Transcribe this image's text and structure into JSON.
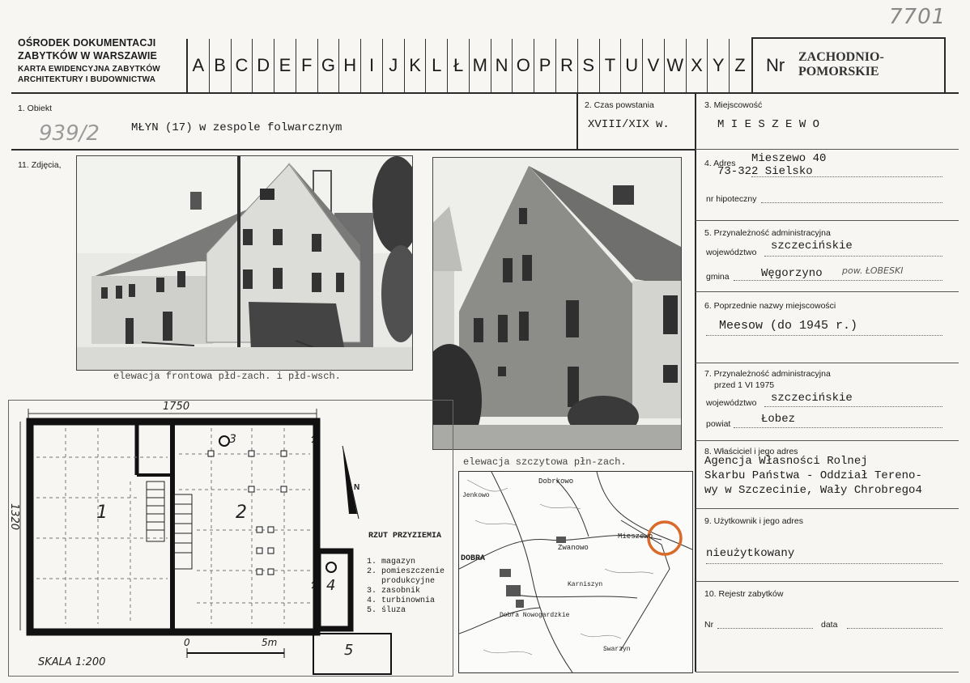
{
  "header": {
    "org_line1": "OŚRODEK DOKUMENTACJI",
    "org_line2": "ZABYTKÓW W WARSZAWIE",
    "org_line3": "KARTA EWIDENCYJNA ZABYTKÓW",
    "org_line4": "ARCHITEKTURY I BUDOWNICTWA",
    "letters": [
      "A",
      "B",
      "C",
      "D",
      "E",
      "F",
      "G",
      "H",
      "I",
      "J",
      "K",
      "L",
      "Ł",
      "M",
      "N",
      "O",
      "P",
      "R",
      "S",
      "T",
      "U",
      "V",
      "W",
      "X",
      "Y",
      "Z"
    ],
    "nr_label": "Nr",
    "region_stamp_line1": "ZACHODNIO-",
    "region_stamp_line2": "POMORSKIE",
    "corner_number": "7701"
  },
  "field1": {
    "label": "1. Obiekt",
    "value": "MŁYN (17) w zespole folwarcznym",
    "handwritten": "939/2"
  },
  "field2": {
    "label": "2. Czas powstania",
    "value": "XVIII/XIX w."
  },
  "field3": {
    "label": "3. Miejscowość",
    "value": "M I E S Z E W O"
  },
  "field11": {
    "label": "11. Zdjęcia,"
  },
  "field4": {
    "label": "4. Adres",
    "line1": "Mieszewo 40",
    "line2": "73-322 Sielsko",
    "hip_label": "nr hipoteczny"
  },
  "field5": {
    "label": "5. Przynależność administracyjna",
    "woj_label": "województwo",
    "woj_value": "szczecińskie",
    "gmina_label": "gmina",
    "gmina_value": "Węgorzyno",
    "gmina_note": "pow. ŁOBESKI"
  },
  "field6": {
    "label": "6. Poprzednie nazwy miejscowości",
    "value": "Meesow (do 1945 r.)"
  },
  "field7": {
    "label": "7. Przynależność administracyjna",
    "sub": "przed 1 VI 1975",
    "woj_label": "województwo",
    "woj_value": "szczecińskie",
    "powiat_label": "powiat",
    "powiat_value": "Łobez"
  },
  "field8": {
    "label": "8. Właściciel i jego adres",
    "line1": "Agencja Własności Rolnej",
    "line2": "Skarbu Państwa - Oddział Tereno-",
    "line3": "wy w Szczecinie, Wały Chrobrego4"
  },
  "field9": {
    "label": "9. Użytkownik i jego adres",
    "value": "nieużytkowany"
  },
  "field10": {
    "label": "10. Rejestr zabytków",
    "nr_label": "Nr",
    "data_label": "data"
  },
  "photos": {
    "caption1": "elewacja frontowa płd-zach. i płd-wsch.",
    "caption2": "elewacja szczytowa płn-zach."
  },
  "plan": {
    "dim_width": "1750",
    "dim_height": "1320",
    "title": "RZUT PRZYZIEMIA",
    "legend": [
      "1. magazyn",
      "2. pomieszczenie",
      "   produkcyjne",
      "3. zasobnik",
      "4. turbinownia",
      "5. śluza"
    ],
    "room1": "1",
    "room2": "2",
    "room3": "3",
    "room4": "4",
    "room5": "5",
    "scale_label": "SKALA 1:200",
    "scale_zero": "0",
    "scale_5m": "5m",
    "north": "N"
  },
  "map": {
    "labels": [
      "Dobrkowo",
      "Mieszewo",
      "Zwanowo",
      "Karniszyn",
      "Dobra Nowogardzkie",
      "Swarzyn",
      "DOBRA",
      "Jenkowo"
    ],
    "circle_color": "#d96a2a"
  }
}
